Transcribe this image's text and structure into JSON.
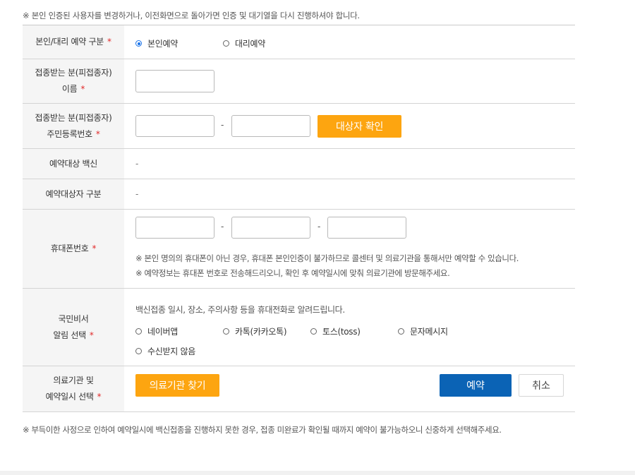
{
  "top_notice": "※ 본인 인증된 사용자를 변경하거나, 이전화면으로 돌아가면 인증 및 대기열을 다시 진행하셔야 합니다.",
  "rows": {
    "reservation_type": {
      "label": "본인/대리 예약 구분",
      "options": [
        {
          "label": "본인예약",
          "selected": true
        },
        {
          "label": "대리예약",
          "selected": false
        }
      ]
    },
    "name": {
      "label_line1": "접종받는 분(피접종자)",
      "label_line2": "이름",
      "value": ""
    },
    "rrn": {
      "label_line1": "접종받는 분(피접종자)",
      "label_line2": "주민등록번호",
      "separator": "-",
      "part1": "",
      "part2": "",
      "confirm_button": "대상자 확인"
    },
    "vaccine": {
      "label": "예약대상 백신",
      "value": "-"
    },
    "target_type": {
      "label": "예약대상자 구분",
      "value": "-"
    },
    "phone": {
      "label": "휴대폰번호",
      "separator": "-",
      "part1": "",
      "part2": "",
      "part3": "",
      "note1": "※ 본인 명의의 휴대폰이 아닌 경우, 휴대폰 본인인증이 불가하므로 콜센터 및 의료기관을 통해서만 예약할 수 있습니다.",
      "note2": "※ 예약정보는 휴대폰 번호로 전송해드리오니, 확인 후 예약일시에 맞춰 의료기관에 방문해주세요."
    },
    "secretary": {
      "label_line1": "국민비서",
      "label_line2": "알림 선택",
      "description": "백신접종 일시, 장소, 주의사항 등을 휴대전화로 알려드립니다.",
      "options": [
        {
          "label": "네이버앱",
          "selected": false
        },
        {
          "label": "카톡(카카오톡)",
          "selected": false
        },
        {
          "label": "토스(toss)",
          "selected": false
        },
        {
          "label": "문자메시지",
          "selected": false
        },
        {
          "label": "수신받지 않음",
          "selected": false
        }
      ]
    },
    "institution": {
      "label_line1": "의료기관 및",
      "label_line2": "예약일시 선택",
      "find_button": "의료기관 찾기",
      "reserve_button": "예약",
      "cancel_button": "취소"
    }
  },
  "required_mark": "*",
  "bottom_notice": "※ 부득이한 사정으로 인하여 예약일시에 백신접종을 진행하지 못한 경우, 접종 미완료가 확인될 때까지 예약이 불가능하오니 신중하게 선택해주세요.",
  "colors": {
    "accent_orange": "#fda510",
    "primary_blue": "#0b63b5",
    "required_red": "#e22a2a",
    "radio_blue": "#1a73e8"
  }
}
